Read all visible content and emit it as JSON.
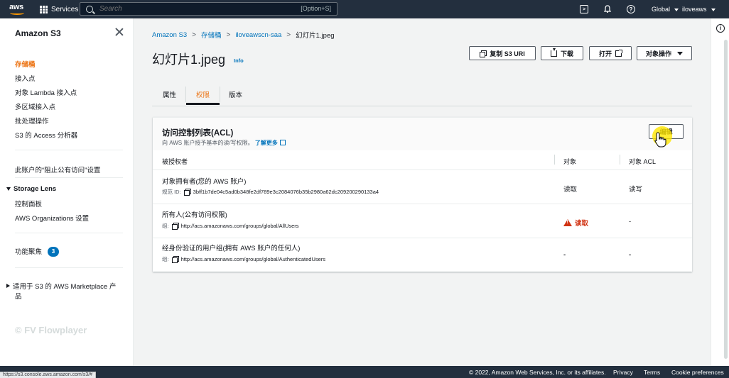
{
  "topnav": {
    "logo_text": "aws",
    "services_label": "Services",
    "search_placeholder": "Search",
    "search_shortcut": "[Option+S]",
    "region_label": "Global",
    "user_label": "iloveaws"
  },
  "sidebar": {
    "title": "Amazon S3",
    "items": [
      "存储桶",
      "接入点",
      "对象 Lambda 接入点",
      "多区域接入点",
      "批处理操作",
      "S3 的 Access 分析器"
    ],
    "block_public_label": "此账户的“阻止公有访问”设置",
    "storage_lens": {
      "header": "Storage Lens",
      "items": [
        "控制面板",
        "AWS Organizations 设置"
      ]
    },
    "feature_spotlight_label": "功能聚焦",
    "feature_spotlight_count": "3",
    "marketplace_line1": "适用于 S3 的 AWS Marketplace 产",
    "marketplace_line2": "品",
    "watermark": "© FV Flowplayer"
  },
  "breadcrumb": [
    "Amazon S3",
    "存储桶",
    "iloveawscn-saa",
    "幻灯片1.jpeg"
  ],
  "page": {
    "title": "幻灯片1.jpeg",
    "info_label": "Info"
  },
  "actions": {
    "copy_uri": "复制 S3 URI",
    "download": "下载",
    "open": "打开",
    "object_actions": "对象操作"
  },
  "tabs": [
    "属性",
    "权限",
    "版本"
  ],
  "acl": {
    "title": "访问控制列表(ACL)",
    "description": "向 AWS 账户授予基本的读/写权限。",
    "learn_more": "了解更多",
    "edit_label": "编辑",
    "columns": [
      "被授权者",
      "对象",
      "对象 ACL"
    ],
    "rows": [
      {
        "grantee": "对象拥有者(您的 AWS 账户)",
        "sub_label": "规范 ID:",
        "sub_value": "3bff1b7de04c5ad0b348fe2df789e3c2084076b35b2980a62dc209200290133a4",
        "object": "读取",
        "object_acl": "读写"
      },
      {
        "grantee": "所有人(公有访问权限)",
        "sub_label": "组:",
        "sub_value": "http://acs.amazonaws.com/groups/global/AllUsers",
        "object": "读取",
        "object_acl": "-"
      },
      {
        "grantee": "经身份验证的用户组(拥有 AWS 账户的任何人)",
        "sub_label": "组:",
        "sub_value": "http://acs.amazonaws.com/groups/global/AuthenticatedUsers",
        "object": "-",
        "object_acl": "-"
      }
    ]
  },
  "footer": {
    "copyright": "© 2022, Amazon Web Services, Inc. or its affiliates.",
    "privacy": "Privacy",
    "terms": "Terms",
    "cookies": "Cookie preferences"
  },
  "status_url": "https://s3.console.aws.amazon.com/s3/#",
  "colors": {
    "nav_bg": "#232f3e",
    "accent_orange": "#ec7211",
    "link_blue": "#0073bb",
    "warning_red": "#d13212"
  }
}
